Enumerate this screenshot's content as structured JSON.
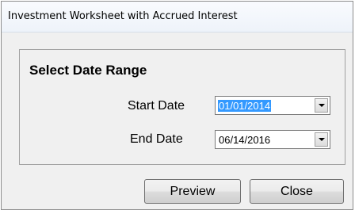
{
  "window": {
    "title": "Investment Worksheet with Accrued Interest"
  },
  "group": {
    "title": "Select Date Range"
  },
  "start_date": {
    "label": "Start Date",
    "value": "01/01/2014"
  },
  "end_date": {
    "label": "End Date",
    "value": "06/14/2016"
  },
  "buttons": {
    "preview": "Preview",
    "close": "Close"
  },
  "icons": {
    "dropdown": "chevron-down-icon"
  },
  "colors": {
    "selection": "#3399ff"
  }
}
